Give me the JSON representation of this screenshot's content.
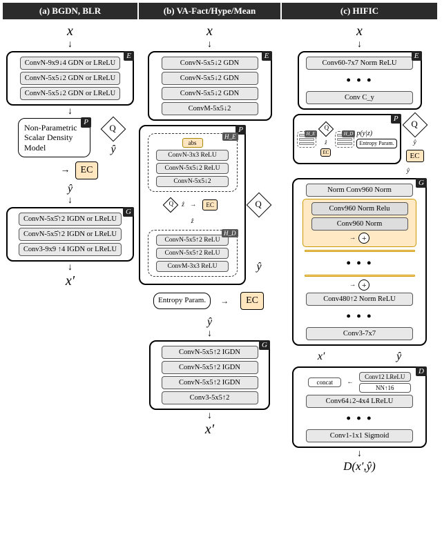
{
  "columns": {
    "a": {
      "title": "(a) BGDN, BLR",
      "input": "x",
      "E": {
        "label": "E",
        "ops": [
          "ConvN-9x9↓4 GDN or LReLU",
          "ConvN-5x5↓2 GDN or LReLU",
          "ConvN-5x5↓2 GDN or LReLU"
        ]
      },
      "P": {
        "label": "P",
        "text": "Non-Parametric Scalar Density Model"
      },
      "Q": "Q",
      "EC": "EC",
      "yhat": "ŷ",
      "G": {
        "label": "G",
        "ops": [
          "ConvN-5x5̂↑2 IGDN or LReLU",
          "ConvN-5x5̂↑2 IGDN or LReLU",
          "Conv3-9x9 ↑4 IGDN or LReLU"
        ]
      },
      "output": "x′"
    },
    "b": {
      "title": "(b) VA-Fact/Hype/Mean",
      "input": "x",
      "E": {
        "label": "E",
        "ops": [
          "ConvN-5x5↓2 GDN",
          "ConvN-5x5↓2 GDN",
          "ConvN-5x5↓2 GDN",
          "ConvM-5x5↓2"
        ]
      },
      "P": {
        "label": "P",
        "HE": {
          "label": "H_E",
          "abs": "abs",
          "ops": [
            "ConvN-3x3  ReLU",
            "ConvN-5x5↓2 ReLU",
            "ConvN-5x5↓2"
          ]
        },
        "mid": {
          "Q": "Q",
          "zhat": "ẑ",
          "EC": "EC",
          "zhatdown": "ẑ"
        },
        "HD": {
          "label": "H_D",
          "ops": [
            "ConvN-5x5↑2 ReLU",
            "ConvN-5x5↑2 ReLU",
            "ConvM-3x3 ReLU"
          ]
        }
      },
      "entropy": "Entropy Param.",
      "Q": "Q",
      "EC": "EC",
      "yhat": "ŷ",
      "G": {
        "label": "G",
        "ops": [
          "ConvN-5x5↑2 IGDN",
          "ConvN-5x5↑2 IGDN",
          "ConvN-5x5↑2 IGDN",
          "Conv3-5x5↑2"
        ]
      },
      "output": "x′"
    },
    "c": {
      "title": "(c) HIFIC",
      "input": "x",
      "E": {
        "label": "E",
        "ops": [
          "Conv60-7x7 Norm ReLU",
          "Conv C_y"
        ],
        "dots": "• • •"
      },
      "P": {
        "label": "P",
        "HE": "H_E",
        "HD": "H_D",
        "Q": "Q",
        "zhat": "ẑ",
        "EC": "EC",
        "pyz": "p(y|z)",
        "entp": "Entropy Param."
      },
      "Q": "Q",
      "EC": "EC",
      "yhat": "ŷ",
      "G": {
        "label": "G",
        "ops_top": [
          "Norm Conv960 Norm"
        ],
        "resid": [
          "Conv960 Norm Relu",
          "Conv960 Norm"
        ],
        "ops_bot": [
          "Conv480↑2 Norm ReLU",
          "Conv3-7x7"
        ]
      },
      "xprime": "x′",
      "yhat2": "ŷ",
      "D": {
        "label": "D",
        "concat": "concat",
        "convh": "Conv12 LReLU",
        "nn": "NN↑16",
        "conv64": "Conv64↓2-4x4 LReLU",
        "conv1": "Conv1-1x1 Sigmoid"
      },
      "output": "D(x′,ŷ)"
    }
  }
}
